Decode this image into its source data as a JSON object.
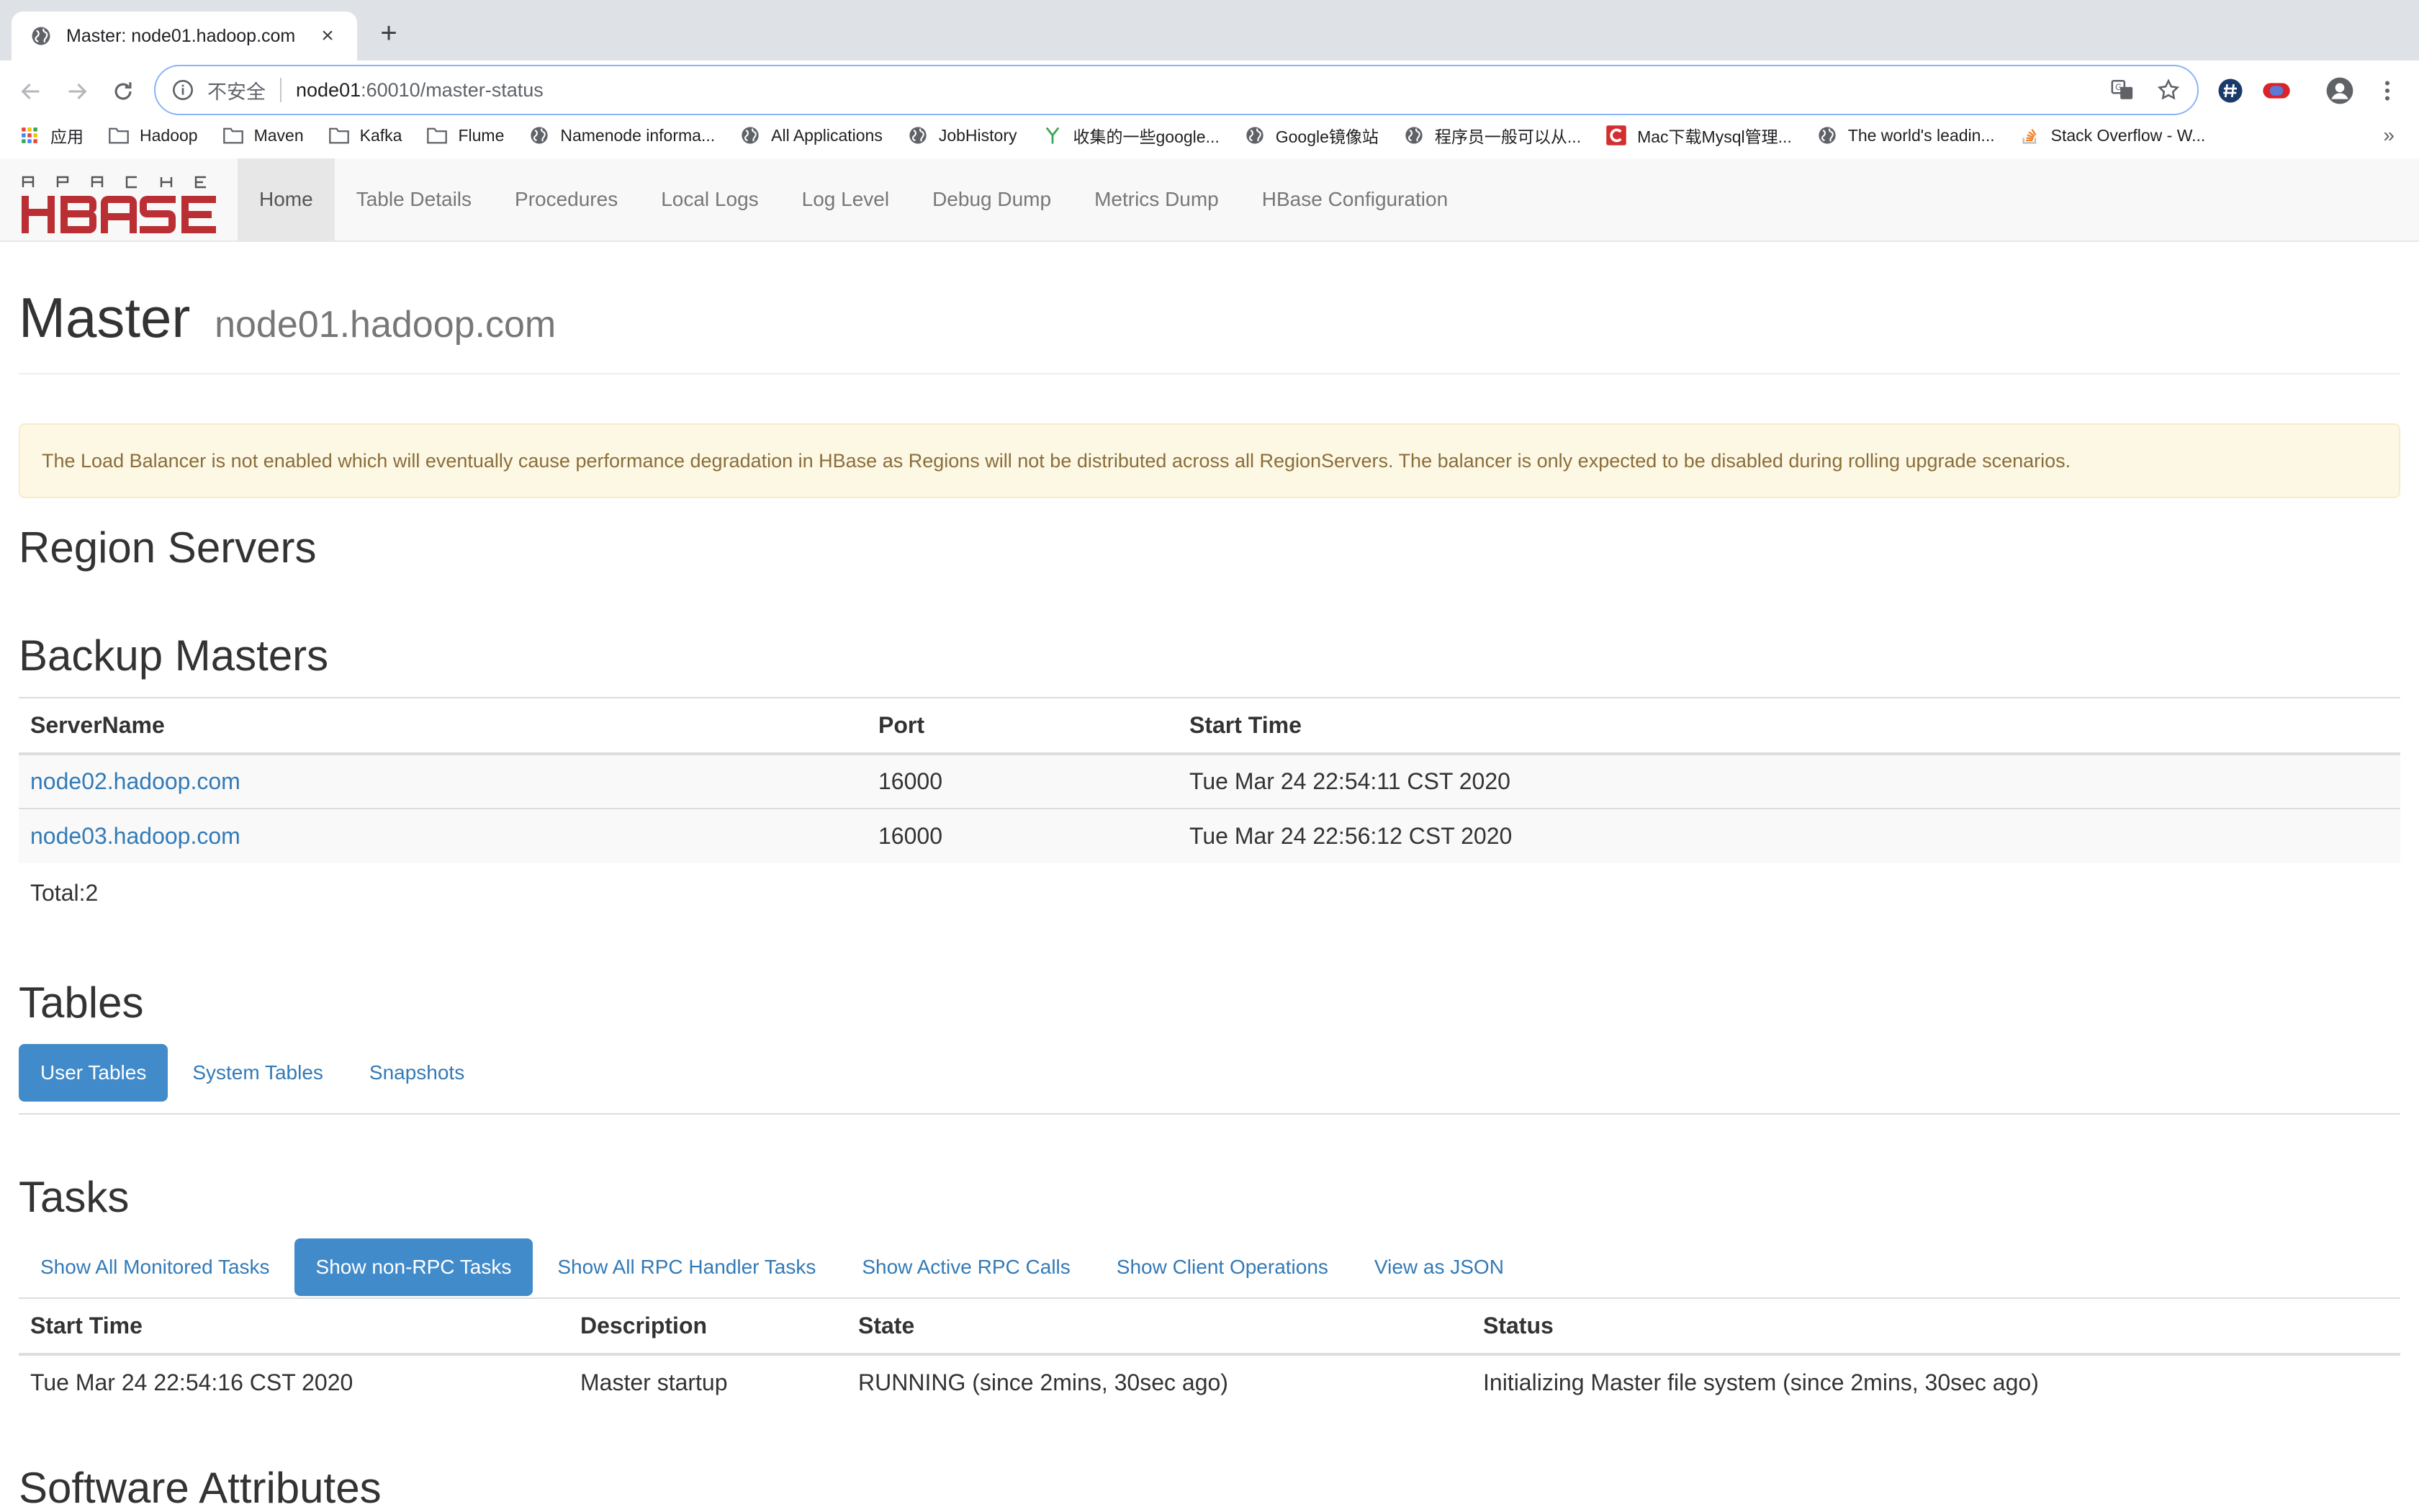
{
  "browser": {
    "tab_title": "Master: node01.hadoop.com",
    "tab_close": "×",
    "new_tab": "+",
    "omnibox": {
      "insecure_label": "不安全",
      "url_host": "node01",
      "url_path": ":60010/master-status"
    },
    "bookmarks": [
      {
        "label": "应用",
        "icon": "apps-grid-icon"
      },
      {
        "label": "Hadoop",
        "icon": "folder-icon"
      },
      {
        "label": "Maven",
        "icon": "folder-icon"
      },
      {
        "label": "Kafka",
        "icon": "folder-icon"
      },
      {
        "label": "Flume",
        "icon": "folder-icon"
      },
      {
        "label": "Namenode informa...",
        "icon": "globe-icon"
      },
      {
        "label": "All Applications",
        "icon": "globe-icon"
      },
      {
        "label": "JobHistory",
        "icon": "globe-icon"
      },
      {
        "label": "收集的一些google...",
        "icon": "y-icon"
      },
      {
        "label": "Google镜像站",
        "icon": "globe-icon"
      },
      {
        "label": "程序员一般可以从...",
        "icon": "globe-icon"
      },
      {
        "label": "Mac下载Mysql管理...",
        "icon": "c-logo-icon"
      },
      {
        "label": "The world's leadin...",
        "icon": "globe-icon"
      },
      {
        "label": "Stack Overflow - W...",
        "icon": "stackoverflow-icon"
      }
    ],
    "bookmarks_more": "»"
  },
  "hbase_nav": {
    "items": [
      "Home",
      "Table Details",
      "Procedures",
      "Local Logs",
      "Log Level",
      "Debug Dump",
      "Metrics Dump",
      "HBase Configuration"
    ],
    "active_index": 0
  },
  "page": {
    "title": "Master",
    "subtitle": "node01.hadoop.com",
    "alert": "The Load Balancer is not enabled which will eventually cause performance degradation in HBase as Regions will not be distributed across all RegionServers. The balancer is only expected to be disabled during rolling upgrade scenarios.",
    "region_servers_heading": "Region Servers",
    "backup_masters": {
      "heading": "Backup Masters",
      "columns": [
        "ServerName",
        "Port",
        "Start Time"
      ],
      "rows": [
        [
          "node02.hadoop.com",
          "16000",
          "Tue Mar 24 22:54:11 CST 2020"
        ],
        [
          "node03.hadoop.com",
          "16000",
          "Tue Mar 24 22:56:12 CST 2020"
        ]
      ],
      "total": "Total:2"
    },
    "tables": {
      "heading": "Tables",
      "tabs": [
        "User Tables",
        "System Tables",
        "Snapshots"
      ],
      "active_index": 0
    },
    "tasks": {
      "heading": "Tasks",
      "tabs": [
        "Show All Monitored Tasks",
        "Show non-RPC Tasks",
        "Show All RPC Handler Tasks",
        "Show Active RPC Calls",
        "Show Client Operations",
        "View as JSON"
      ],
      "active_index": 1,
      "columns": [
        "Start Time",
        "Description",
        "State",
        "Status"
      ],
      "rows": [
        [
          "Tue Mar 24 22:54:16 CST 2020",
          "Master startup",
          "RUNNING (since 2mins, 30sec ago)",
          "Initializing Master file system (since 2mins, 30sec ago)"
        ]
      ]
    },
    "software_attributes_heading": "Software Attributes"
  },
  "colors": {
    "link": "#337ab7",
    "pill_active": "#428bca",
    "alert_bg": "#fcf8e3",
    "alert_text": "#8a6d3b",
    "logo_red": "#ba2f34"
  }
}
